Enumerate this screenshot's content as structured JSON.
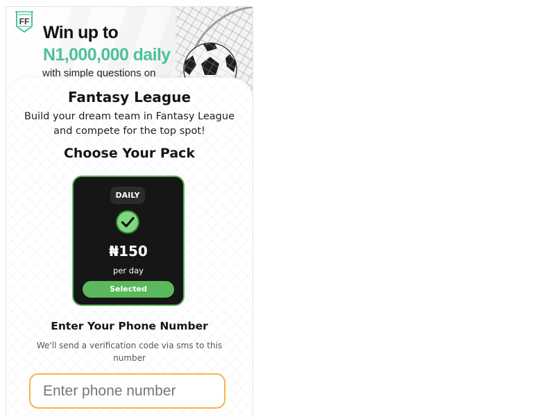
{
  "banner": {
    "line1": "Win up to",
    "line2": "N1,000,000 daily",
    "line3": "with simple questions on",
    "logo_text": "FF"
  },
  "page": {
    "title": "Fantasy League",
    "subtitle": "Build your dream team in Fantasy League and compete for the top spot!",
    "choose_heading": "Choose Your Pack"
  },
  "pack": {
    "badge": "DAILY",
    "price": "₦150",
    "period": "per day",
    "button_label": "Selected"
  },
  "phone_section": {
    "heading": "Enter Your Phone Number",
    "description": "We'll send a verification code via sms to this number",
    "input_placeholder": "Enter phone number",
    "input_value": ""
  },
  "colors": {
    "accent_green": "#5cb85c",
    "banner_green": "#4cc29a",
    "input_border": "#f5b547",
    "pack_background": "#161616"
  },
  "icons": [
    "brand-logo-icon",
    "check-icon",
    "football-net-image"
  ]
}
